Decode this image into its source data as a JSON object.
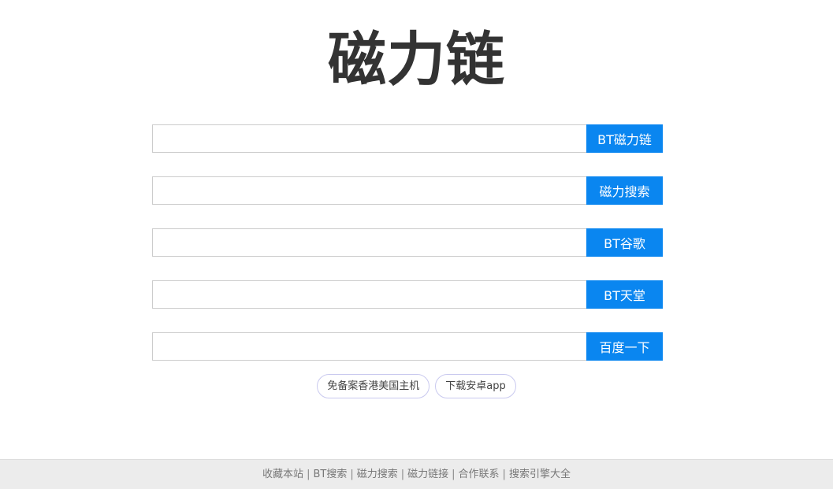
{
  "header": {
    "title": "磁力链"
  },
  "search_rows": [
    {
      "value": "",
      "placeholder": "",
      "button_label": "BT磁力链"
    },
    {
      "value": "",
      "placeholder": "",
      "button_label": "磁力搜索"
    },
    {
      "value": "",
      "placeholder": "",
      "button_label": "BT谷歌"
    },
    {
      "value": "",
      "placeholder": "",
      "button_label": "BT天堂"
    },
    {
      "value": "",
      "placeholder": "",
      "button_label": "百度一下"
    }
  ],
  "links": [
    {
      "label": "免备案香港美国主机"
    },
    {
      "label": "下载安卓app"
    }
  ],
  "footer": {
    "items": [
      "收藏本站",
      "BT搜索",
      "磁力搜索",
      "磁力链接",
      "合作联系",
      "搜索引擎大全"
    ],
    "separator": "|"
  },
  "colors": {
    "button_bg": "#0a86f0",
    "button_text": "#ffffff",
    "title": "#333333",
    "footer_bg": "#ececec"
  }
}
